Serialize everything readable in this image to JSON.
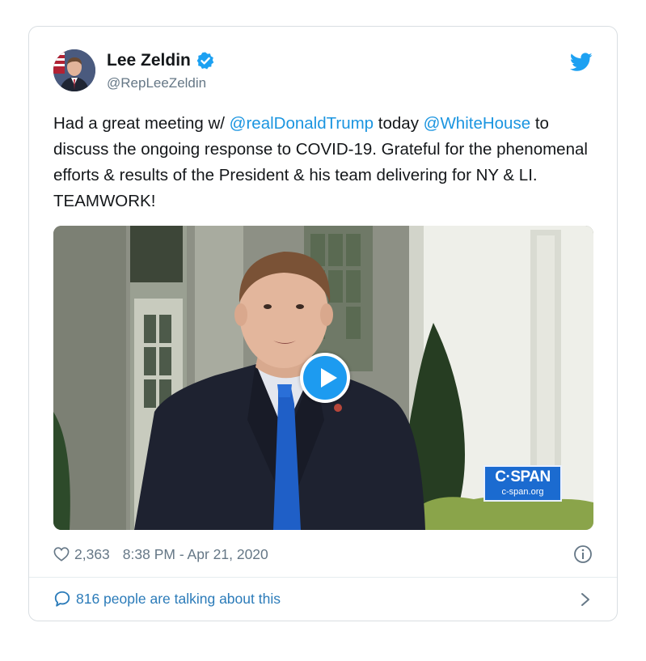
{
  "tweet": {
    "author": {
      "name": "Lee Zeldin",
      "handle": "@RepLeeZeldin",
      "verified": true
    },
    "text": {
      "part1": "Had a great meeting w/ ",
      "mention1": "@realDonaldTrump",
      "part2": " today ",
      "mention2": "@WhiteHouse",
      "part3": " to discuss the ongoing response to COVID-19. Grateful for the phenomenal efforts & results of the President & his team delivering for NY & LI. TEAMWORK!"
    },
    "media": {
      "type": "video",
      "watermark": "C·SPAN",
      "watermark_sub": "c-span.org"
    },
    "likes": "2,363",
    "timestamp": "8:38 PM - Apr 21, 2020",
    "conversation": "816 people are talking about this"
  },
  "colors": {
    "accent": "#1b95e0",
    "link": "#2b7bb9",
    "muted": "#657786",
    "play_button": "#1d9bf0",
    "cspan_blue": "#1b6bd0"
  },
  "icons": [
    "verified-badge-icon",
    "twitter-bird-icon",
    "play-icon",
    "heart-icon",
    "info-icon",
    "speech-bubble-icon",
    "chevron-right-icon"
  ]
}
